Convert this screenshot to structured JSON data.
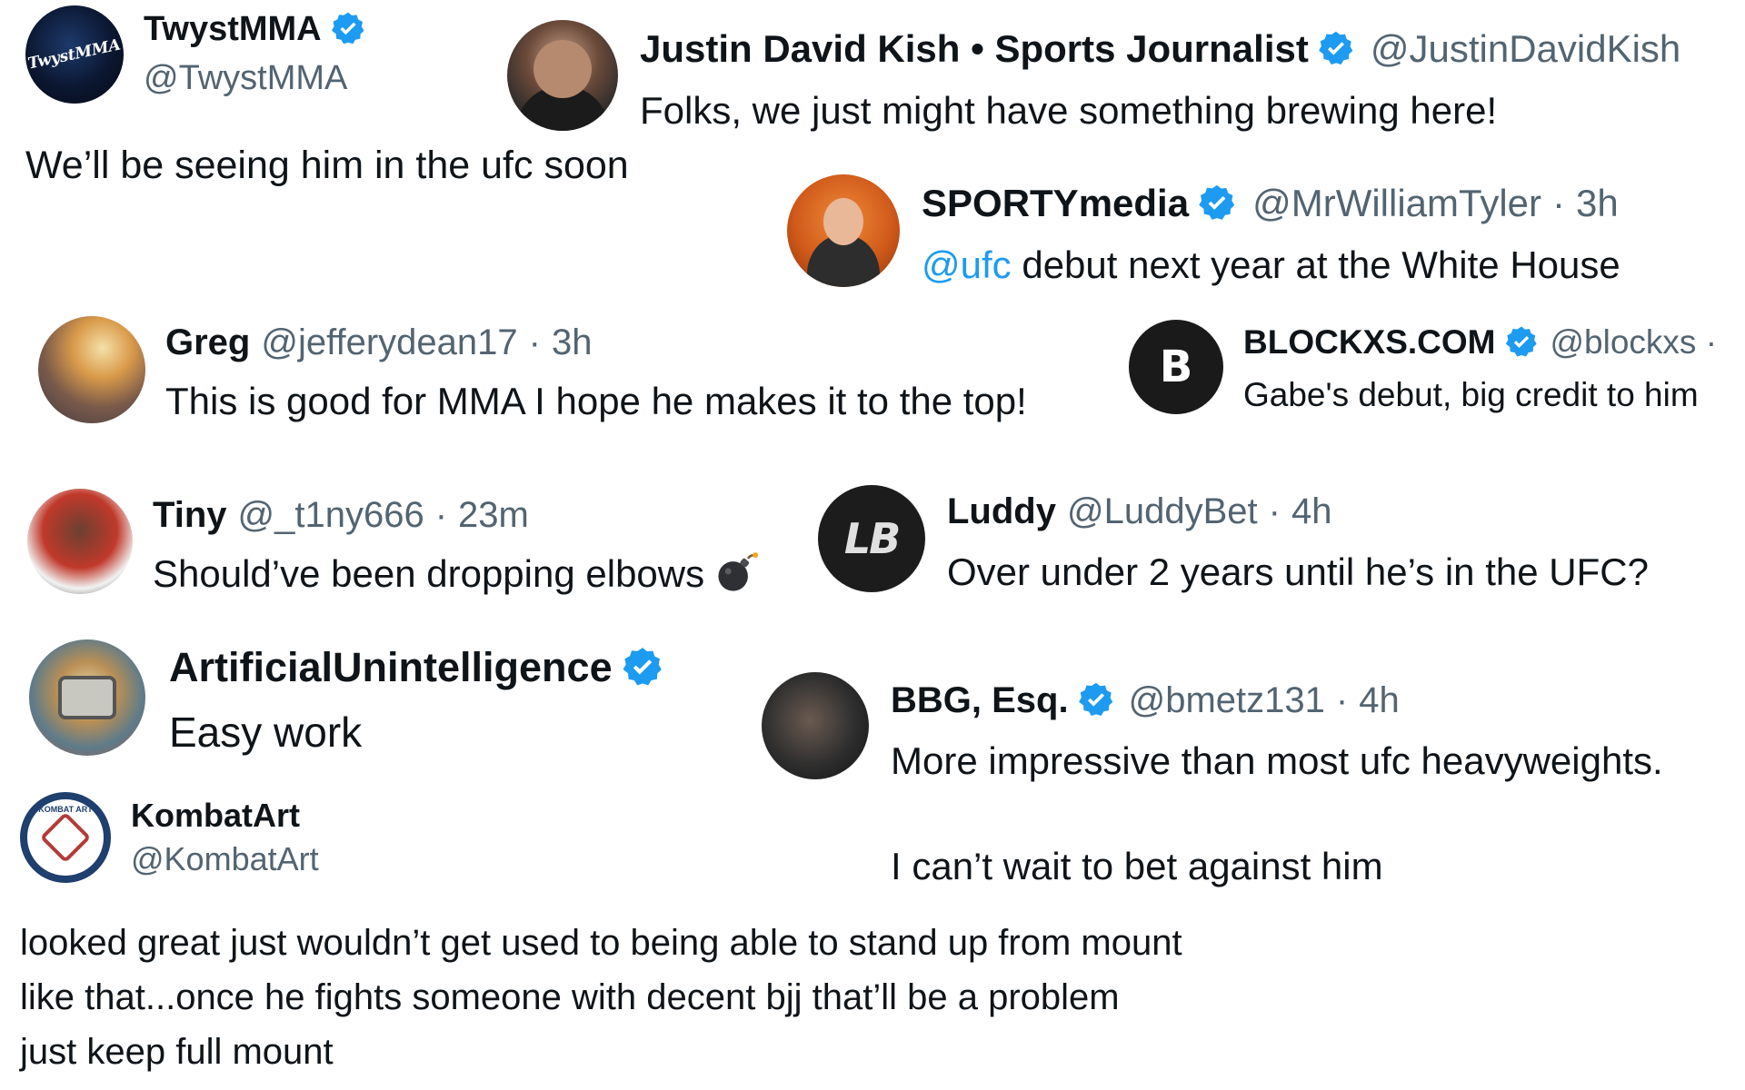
{
  "colors": {
    "verified": "#1d9bf0",
    "mention": "#1d9bf0",
    "handle": "#536471",
    "text": "#0f1419"
  },
  "posts": [
    {
      "id": "twyst",
      "name": "TwystMMA",
      "handle": "@TwystMMA",
      "verified": true,
      "avatar_text": "TwystMMA",
      "text": "We’ll be seeing him in the ufc soon"
    },
    {
      "id": "kish",
      "name": "Justin David Kish • Sports Journalist",
      "handle": "@JustinDavidKish",
      "verified": true,
      "text": "Folks, we just might have something brewing here!"
    },
    {
      "id": "sporty",
      "name": "SPORTYmedia",
      "handle": "@MrWilliamTyler",
      "time": "3h",
      "verified": true,
      "mention": "@ufc",
      "text": " debut next year at the White House"
    },
    {
      "id": "greg",
      "name": "Greg",
      "handle": "@jefferydean17",
      "time": "3h",
      "text": "This is good for MMA I hope he makes it to the top!"
    },
    {
      "id": "blockxs",
      "name": "BLOCKXS.COM",
      "handle": "@blockxs ·",
      "verified": true,
      "avatar_text": "B",
      "text": "Gabe's debut, big credit to him"
    },
    {
      "id": "tiny",
      "name": "Tiny",
      "handle": "@_t1ny666",
      "time": "23m",
      "text": "Should’ve been dropping elbows",
      "emoji": "bomb-icon"
    },
    {
      "id": "luddy",
      "name": "Luddy",
      "handle": "@LuddyBet",
      "time": "4h",
      "avatar_text": "LB",
      "text": "Over under 2 years until he’s in the UFC?"
    },
    {
      "id": "ai",
      "name": "ArtificialUnintelligence",
      "verified": true,
      "text": "Easy work"
    },
    {
      "id": "bbg",
      "name": "BBG, Esq.",
      "handle": "@bmetz131",
      "time": "4h",
      "verified": true,
      "text": "More impressive than most ufc heavyweights.",
      "text2": "I can’t wait to bet against him"
    },
    {
      "id": "kombat",
      "name": "KombatArt",
      "handle": "@KombatArt",
      "avatar_text": "KOMBAT ART",
      "lines": [
        "looked great just wouldn’t get used to being able to stand up from mount",
        "like that...once he fights someone with decent bjj that’ll be a problem",
        "just keep full mount"
      ]
    }
  ],
  "sep": "·"
}
